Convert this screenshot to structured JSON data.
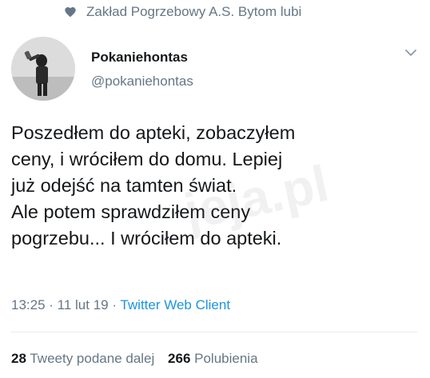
{
  "social_context": {
    "icon": "heart-icon",
    "text": "Zakład Pogrzebowy A.S. Bytom lubi"
  },
  "author": {
    "name": "Pokaniehontas",
    "handle": "@pokaniehontas",
    "avatar": "black-and-white-photo-person-drinking"
  },
  "menu": {
    "icon": "chevron-down-icon"
  },
  "tweet": {
    "lines": [
      "Poszedłem do apteki, zobaczyłem",
      "ceny, i wróciłem do domu. Lepiej",
      "już odejść na tamten świat.",
      "Ale potem sprawdziłem ceny",
      "pogrzebu... I wróciłem do apteki."
    ]
  },
  "meta": {
    "time": "13:25",
    "date": "11 lut 19",
    "separator": " · ",
    "client": "Twitter Web Client"
  },
  "stats": {
    "retweets_count": "28",
    "retweets_label": "Tweety podane dalej",
    "likes_count": "266",
    "likes_label": "Polubienia"
  },
  "watermark": "jeja.pl",
  "colors": {
    "text": "#14171a",
    "secondary": "#657786",
    "link": "#1b95e0"
  }
}
